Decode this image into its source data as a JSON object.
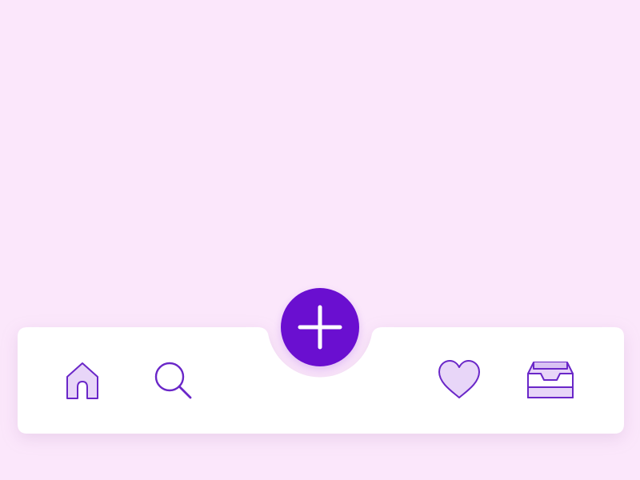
{
  "colors": {
    "background": "#fbe7fb",
    "tab_bar": "#ffffff",
    "accent": "#6a0fd0",
    "icon_stroke": "#6a27c8",
    "icon_fill": "#e8d6f8"
  },
  "tab_bar": {
    "items": [
      {
        "id": "home",
        "icon": "home-icon"
      },
      {
        "id": "search",
        "icon": "search-icon"
      },
      {
        "id": "favorites",
        "icon": "heart-icon"
      },
      {
        "id": "inbox",
        "icon": "inbox-tray-icon"
      }
    ]
  },
  "fab": {
    "icon": "plus-icon"
  }
}
